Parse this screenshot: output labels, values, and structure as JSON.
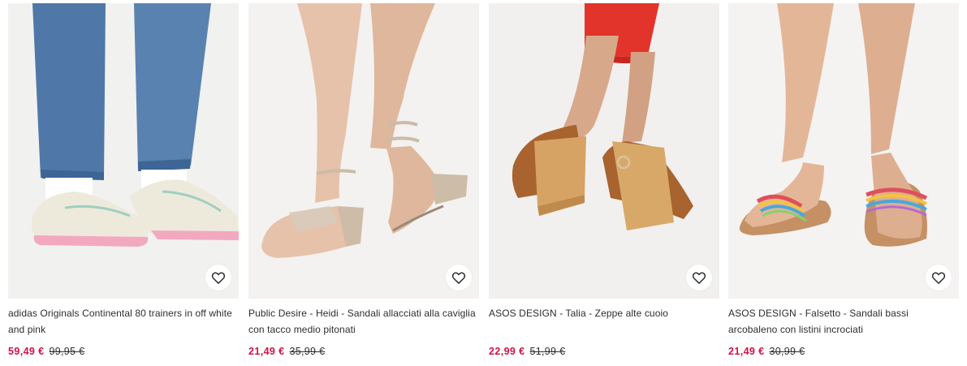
{
  "products": [
    {
      "title": "adidas Originals Continental 80 trainers in off white and pink",
      "sale_price": "59,49 €",
      "original_price": "99,95 €",
      "image_icon": "product-photo-sneakers"
    },
    {
      "title": "Public Desire - Heidi - Sandali allacciati alla caviglia con tacco medio pitonati",
      "sale_price": "21,49 €",
      "original_price": "35,99 €",
      "image_icon": "product-photo-snake-sandals"
    },
    {
      "title": "ASOS DESIGN - Talia - Zeppe alte cuoio",
      "sale_price": "22,99 €",
      "original_price": "51,99 €",
      "image_icon": "product-photo-wedges"
    },
    {
      "title": "ASOS DESIGN - Falsetto - Sandali bassi arcobaleno con listini incrociati",
      "sale_price": "21,49 €",
      "original_price": "30,99 €",
      "image_icon": "product-photo-rainbow-sliders"
    }
  ],
  "colors": {
    "sale": "#d01345",
    "text": "#2d2d2d",
    "image_bg": "#efeeec"
  },
  "favorite_icon": "heart-outline-icon"
}
